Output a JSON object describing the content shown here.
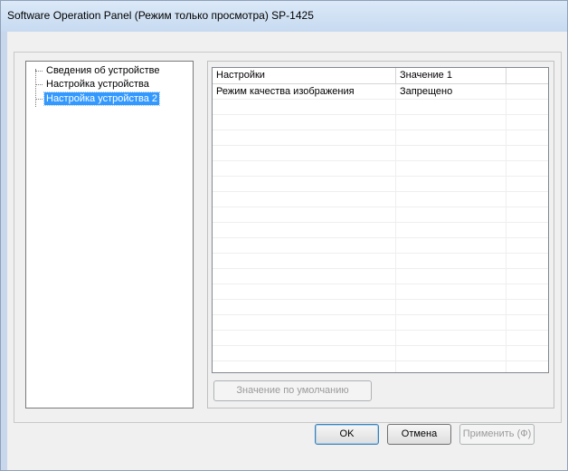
{
  "window": {
    "title": "Software Operation Panel (Режим только просмотра) SP-1425"
  },
  "tree": {
    "items": [
      {
        "label": "Сведения об устройстве",
        "selected": false
      },
      {
        "label": "Настройка устройства",
        "selected": false
      },
      {
        "label": "Настройка устройства 2",
        "selected": true
      }
    ]
  },
  "list": {
    "columns": [
      "Настройки",
      "Значение 1",
      ""
    ],
    "rows": [
      {
        "setting": "Режим качества изображения",
        "value": "Запрещено"
      }
    ]
  },
  "buttons": {
    "default_value": "Значение по умолчанию",
    "ok": "OK",
    "cancel": "Отмена",
    "apply": "Применить (Ф)"
  }
}
